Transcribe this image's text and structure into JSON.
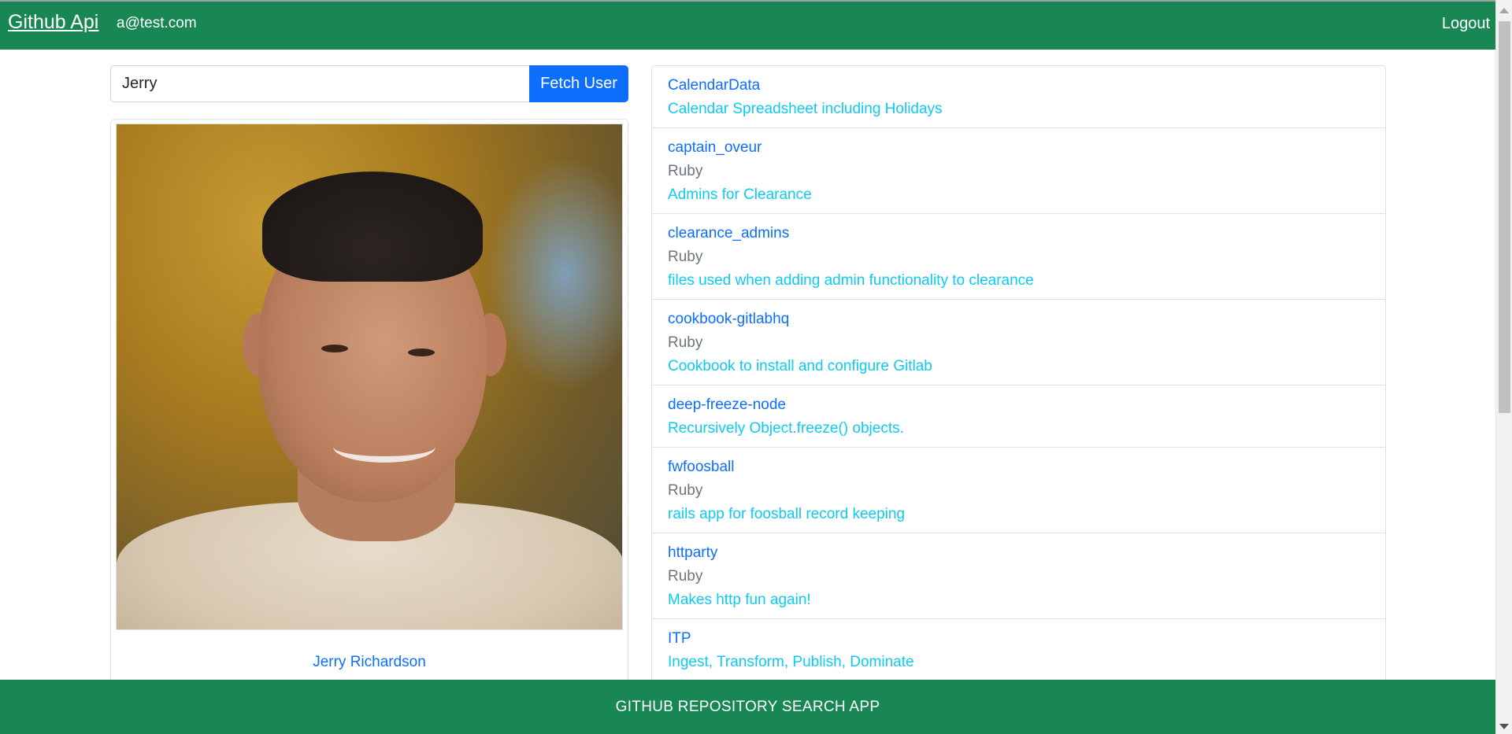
{
  "navbar": {
    "brand": "Github Api",
    "email": "a@test.com",
    "logout": "Logout"
  },
  "search": {
    "value": "Jerry",
    "button_label": "Fetch User"
  },
  "profile": {
    "name": "Jerry Richardson"
  },
  "repos": [
    {
      "name": "CalendarData",
      "language": "",
      "description": "Calendar Spreadsheet including Holidays"
    },
    {
      "name": "captain_oveur",
      "language": "Ruby",
      "description": "Admins for Clearance"
    },
    {
      "name": "clearance_admins",
      "language": "Ruby",
      "description": "files used when adding admin functionality to clearance"
    },
    {
      "name": "cookbook-gitlabhq",
      "language": "Ruby",
      "description": "Cookbook to install and configure Gitlab"
    },
    {
      "name": "deep-freeze-node",
      "language": "",
      "description": "Recursively Object.freeze() objects."
    },
    {
      "name": "fwfoosball",
      "language": "Ruby",
      "description": "rails app for foosball record keeping"
    },
    {
      "name": "httparty",
      "language": "Ruby",
      "description": "Makes http fun again!"
    },
    {
      "name": "ITP",
      "language": "",
      "description": "Ingest, Transform, Publish, Dominate"
    }
  ],
  "footer": {
    "text": "GITHUB REPOSITORY SEARCH APP"
  },
  "colors": {
    "navbar": "#198754",
    "primary": "#0d6efd",
    "info": "#0dcaf0",
    "muted": "#6c757d"
  }
}
